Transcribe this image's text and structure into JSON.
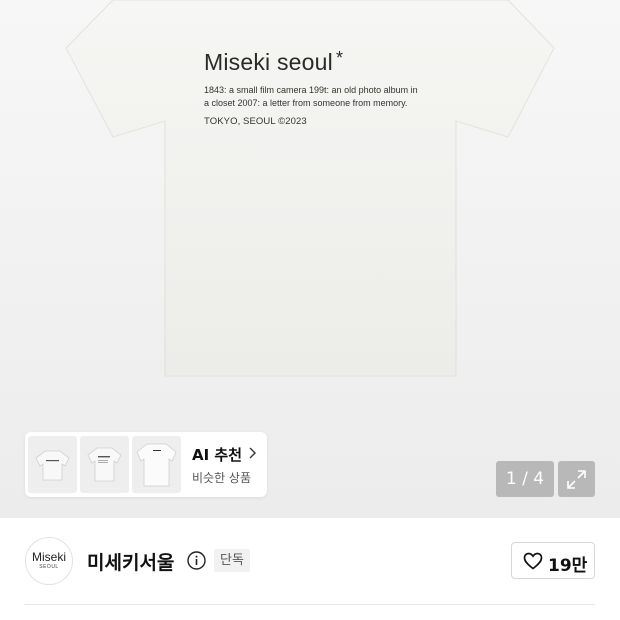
{
  "product_image": {
    "brand_print": "Miseki seoul",
    "brand_mark": "*",
    "story_text": "1843: a small film camera 199t: an old photo album in a closet 2007: a letter from someone from memory.",
    "origin_text": "TOKYO, SEOUL ©2023",
    "shirt_color": "#f4f4f2"
  },
  "recommendation": {
    "title": "AI 추천",
    "subtitle": "비슷한 상품",
    "chevron_icon": "chevron-right-icon",
    "thumbnail_count": 3
  },
  "gallery": {
    "pager": "1 / 4",
    "expand_icon": "expand-icon"
  },
  "store": {
    "logo_text": "Miseki",
    "logo_subtext": "SEOUL",
    "name": "미세키서울",
    "info_icon": "info-icon",
    "badge": "단독",
    "like_icon": "heart-icon",
    "like_count": "19만"
  }
}
